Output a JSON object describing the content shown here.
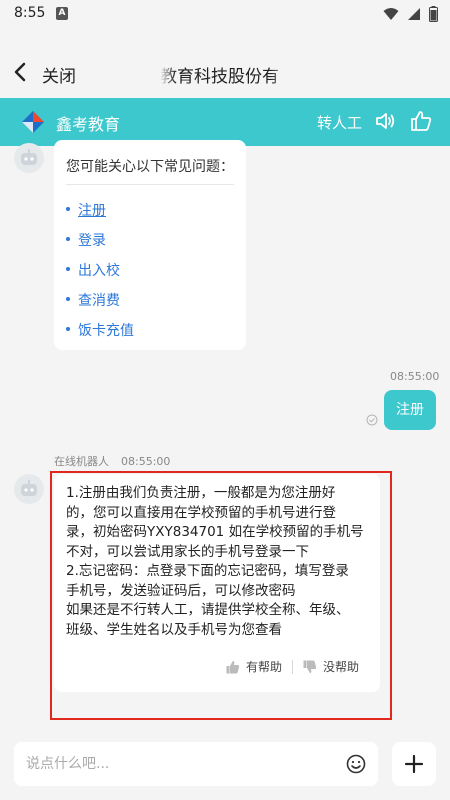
{
  "status_bar": {
    "time": "8:55",
    "notification_icon": "a-box-icon"
  },
  "nav": {
    "close_label": "关闭",
    "title": "教育科技股份有"
  },
  "chat_header": {
    "brand_name": "鑫考教育",
    "transfer_label": "转人工"
  },
  "faq": {
    "title": "您可能关心以下常见问题：",
    "items": [
      "注册",
      "登录",
      "出入校",
      "查消费",
      "饭卡充值"
    ]
  },
  "user_message": {
    "time": "08:55:00",
    "text": "注册"
  },
  "bot_message": {
    "sender": "在线机器人",
    "time": "08:55:00",
    "lines": [
      "1.注册由我们负责注册，一般都是为您注册好",
      "的，您可以直接用在学校预留的手机号进行登",
      "录，初始密码YXY834701 如在学校预留的手机号",
      "不对，可以尝试用家长的手机号登录一下",
      "2.忘记密码：点登录下面的忘记密码，填写登录",
      "手机号，发送验证码后，可以修改密码",
      "如果还是不行转人工，请提供学校全称、年级、",
      "班级、学生姓名以及手机号为您查看"
    ],
    "helpful_label": "有帮助",
    "not_helpful_label": "没帮助"
  },
  "input": {
    "placeholder": "说点什么吧..."
  },
  "colors": {
    "accent": "#3cc8cc",
    "link": "#2d78d7",
    "highlight": "#e0281e"
  }
}
